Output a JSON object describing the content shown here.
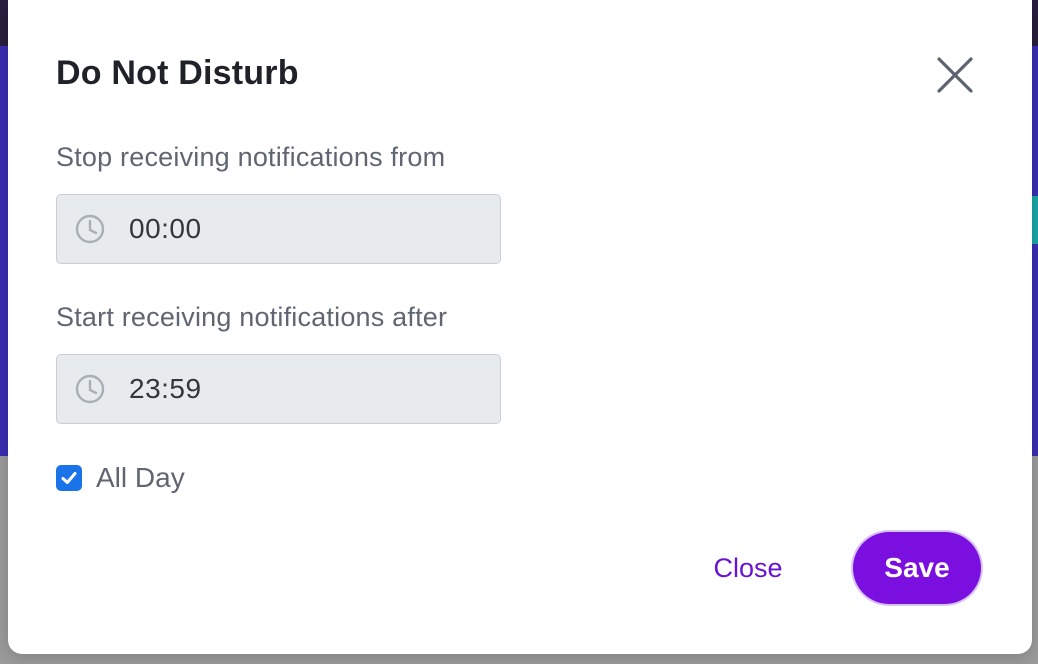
{
  "dialog": {
    "title": "Do Not Disturb",
    "close_icon": "close-icon"
  },
  "stop_from": {
    "label": "Stop receiving notifications from",
    "value": "00:00",
    "icon": "clock-icon"
  },
  "start_after": {
    "label": "Start receiving notifications after",
    "value": "23:59",
    "icon": "clock-icon"
  },
  "all_day": {
    "label": "All Day",
    "checked": true
  },
  "actions": {
    "close_label": "Close",
    "save_label": "Save"
  },
  "colors": {
    "accent": "#7b0fe0",
    "link": "#6a12d6",
    "checkbox": "#1a73e8"
  }
}
